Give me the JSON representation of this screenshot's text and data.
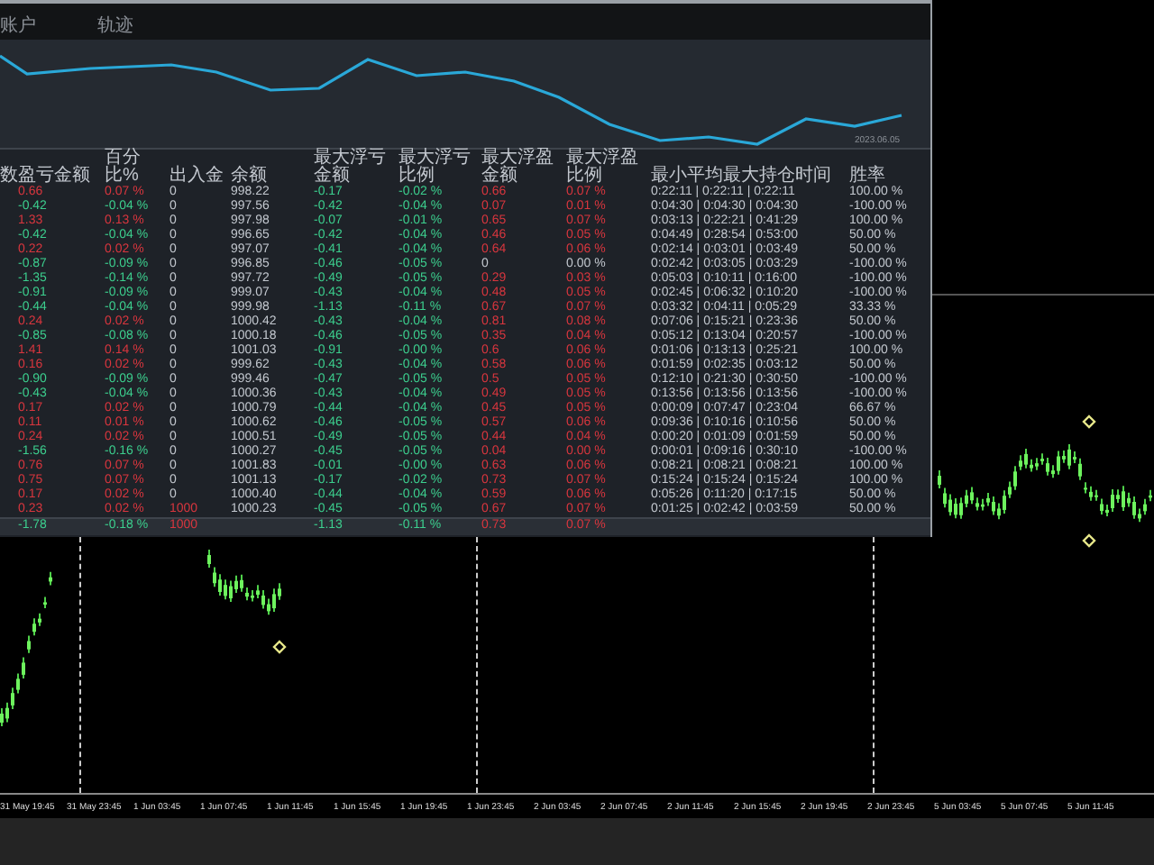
{
  "tabs": [
    {
      "label": "账户"
    },
    {
      "label": "轨迹"
    }
  ],
  "equity_chart": {
    "date_label": "2023.06.05"
  },
  "table": {
    "columns": [
      "数",
      "盈亏金额",
      "百分比%",
      "出入金",
      "余额",
      "最大浮亏金额",
      "最大浮亏比例",
      "最大浮盈金额",
      "最大浮盈比例",
      "最小平均最大持仓时间",
      "胜率"
    ],
    "rows": [
      {
        "cells": [
          {
            "text": ""
          },
          {
            "text": "0.66",
            "kind": "gain"
          },
          {
            "text": "0.07 %",
            "kind": "gain"
          },
          {
            "text": "0",
            "kind": "plain"
          },
          {
            "text": "998.22",
            "kind": "plain"
          },
          {
            "text": "-0.17",
            "kind": "loss"
          },
          {
            "text": "-0.02 %",
            "kind": "loss"
          },
          {
            "text": "0.66",
            "kind": "gain"
          },
          {
            "text": "0.07 %",
            "kind": "gain"
          },
          {
            "text": "0:22:11 | 0:22:11 | 0:22:11",
            "kind": "plain"
          },
          {
            "text": "100.00 %",
            "kind": "plain"
          }
        ]
      },
      {
        "cells": [
          {
            "text": ""
          },
          {
            "text": "-0.42",
            "kind": "loss"
          },
          {
            "text": "-0.04 %",
            "kind": "loss"
          },
          {
            "text": "0",
            "kind": "plain"
          },
          {
            "text": "997.56",
            "kind": "plain"
          },
          {
            "text": "-0.42",
            "kind": "loss"
          },
          {
            "text": "-0.04 %",
            "kind": "loss"
          },
          {
            "text": "0.07",
            "kind": "gain"
          },
          {
            "text": "0.01 %",
            "kind": "gain"
          },
          {
            "text": "0:04:30 | 0:04:30 | 0:04:30",
            "kind": "plain"
          },
          {
            "text": "-100.00 %",
            "kind": "plain"
          }
        ]
      },
      {
        "cells": [
          {
            "text": ""
          },
          {
            "text": "1.33",
            "kind": "gain"
          },
          {
            "text": "0.13 %",
            "kind": "gain"
          },
          {
            "text": "0",
            "kind": "plain"
          },
          {
            "text": "997.98",
            "kind": "plain"
          },
          {
            "text": "-0.07",
            "kind": "loss"
          },
          {
            "text": "-0.01 %",
            "kind": "loss"
          },
          {
            "text": "0.65",
            "kind": "gain"
          },
          {
            "text": "0.07 %",
            "kind": "gain"
          },
          {
            "text": "0:03:13 | 0:22:21 | 0:41:29",
            "kind": "plain"
          },
          {
            "text": "100.00 %",
            "kind": "plain"
          }
        ]
      },
      {
        "cells": [
          {
            "text": ""
          },
          {
            "text": "-0.42",
            "kind": "loss"
          },
          {
            "text": "-0.04 %",
            "kind": "loss"
          },
          {
            "text": "0",
            "kind": "plain"
          },
          {
            "text": "996.65",
            "kind": "plain"
          },
          {
            "text": "-0.42",
            "kind": "loss"
          },
          {
            "text": "-0.04 %",
            "kind": "loss"
          },
          {
            "text": "0.46",
            "kind": "gain"
          },
          {
            "text": "0.05 %",
            "kind": "gain"
          },
          {
            "text": "0:04:49 | 0:28:54 | 0:53:00",
            "kind": "plain"
          },
          {
            "text": "50.00 %",
            "kind": "plain"
          }
        ]
      },
      {
        "cells": [
          {
            "text": ""
          },
          {
            "text": "0.22",
            "kind": "gain"
          },
          {
            "text": "0.02 %",
            "kind": "gain"
          },
          {
            "text": "0",
            "kind": "plain"
          },
          {
            "text": "997.07",
            "kind": "plain"
          },
          {
            "text": "-0.41",
            "kind": "loss"
          },
          {
            "text": "-0.04 %",
            "kind": "loss"
          },
          {
            "text": "0.64",
            "kind": "gain"
          },
          {
            "text": "0.06 %",
            "kind": "gain"
          },
          {
            "text": "0:02:14 | 0:03:01 | 0:03:49",
            "kind": "plain"
          },
          {
            "text": "50.00 %",
            "kind": "plain"
          }
        ]
      },
      {
        "cells": [
          {
            "text": ""
          },
          {
            "text": "-0.87",
            "kind": "loss"
          },
          {
            "text": "-0.09 %",
            "kind": "loss"
          },
          {
            "text": "0",
            "kind": "plain"
          },
          {
            "text": "996.85",
            "kind": "plain"
          },
          {
            "text": "-0.46",
            "kind": "loss"
          },
          {
            "text": "-0.05 %",
            "kind": "loss"
          },
          {
            "text": "0",
            "kind": "plain"
          },
          {
            "text": "0.00 %",
            "kind": "plain"
          },
          {
            "text": "0:02:42 | 0:03:05 | 0:03:29",
            "kind": "plain"
          },
          {
            "text": "-100.00 %",
            "kind": "plain"
          }
        ]
      },
      {
        "cells": [
          {
            "text": ""
          },
          {
            "text": "-1.35",
            "kind": "loss"
          },
          {
            "text": "-0.14 %",
            "kind": "loss"
          },
          {
            "text": "0",
            "kind": "plain"
          },
          {
            "text": "997.72",
            "kind": "plain"
          },
          {
            "text": "-0.49",
            "kind": "loss"
          },
          {
            "text": "-0.05 %",
            "kind": "loss"
          },
          {
            "text": "0.29",
            "kind": "gain"
          },
          {
            "text": "0.03 %",
            "kind": "gain"
          },
          {
            "text": "0:05:03 | 0:10:11 | 0:16:00",
            "kind": "plain"
          },
          {
            "text": "-100.00 %",
            "kind": "plain"
          }
        ]
      },
      {
        "cells": [
          {
            "text": ""
          },
          {
            "text": "-0.91",
            "kind": "loss"
          },
          {
            "text": "-0.09 %",
            "kind": "loss"
          },
          {
            "text": "0",
            "kind": "plain"
          },
          {
            "text": "999.07",
            "kind": "plain"
          },
          {
            "text": "-0.43",
            "kind": "loss"
          },
          {
            "text": "-0.04 %",
            "kind": "loss"
          },
          {
            "text": "0.48",
            "kind": "gain"
          },
          {
            "text": "0.05 %",
            "kind": "gain"
          },
          {
            "text": "0:02:45 | 0:06:32 | 0:10:20",
            "kind": "plain"
          },
          {
            "text": "-100.00 %",
            "kind": "plain"
          }
        ]
      },
      {
        "cells": [
          {
            "text": ""
          },
          {
            "text": "-0.44",
            "kind": "loss"
          },
          {
            "text": "-0.04 %",
            "kind": "loss"
          },
          {
            "text": "0",
            "kind": "plain"
          },
          {
            "text": "999.98",
            "kind": "plain"
          },
          {
            "text": "-1.13",
            "kind": "loss"
          },
          {
            "text": "-0.11 %",
            "kind": "loss"
          },
          {
            "text": "0.67",
            "kind": "gain"
          },
          {
            "text": "0.07 %",
            "kind": "gain"
          },
          {
            "text": "0:03:32 | 0:04:11 | 0:05:29",
            "kind": "plain"
          },
          {
            "text": "33.33 %",
            "kind": "plain"
          }
        ]
      },
      {
        "cells": [
          {
            "text": ""
          },
          {
            "text": "0.24",
            "kind": "gain"
          },
          {
            "text": "0.02 %",
            "kind": "gain"
          },
          {
            "text": "0",
            "kind": "plain"
          },
          {
            "text": "1000.42",
            "kind": "plain"
          },
          {
            "text": "-0.43",
            "kind": "loss"
          },
          {
            "text": "-0.04 %",
            "kind": "loss"
          },
          {
            "text": "0.81",
            "kind": "gain"
          },
          {
            "text": "0.08 %",
            "kind": "gain"
          },
          {
            "text": "0:07:06 | 0:15:21 | 0:23:36",
            "kind": "plain"
          },
          {
            "text": "50.00 %",
            "kind": "plain"
          }
        ]
      },
      {
        "cells": [
          {
            "text": ""
          },
          {
            "text": "-0.85",
            "kind": "loss"
          },
          {
            "text": "-0.08 %",
            "kind": "loss"
          },
          {
            "text": "0",
            "kind": "plain"
          },
          {
            "text": "1000.18",
            "kind": "plain"
          },
          {
            "text": "-0.46",
            "kind": "loss"
          },
          {
            "text": "-0.05 %",
            "kind": "loss"
          },
          {
            "text": "0.35",
            "kind": "gain"
          },
          {
            "text": "0.04 %",
            "kind": "gain"
          },
          {
            "text": "0:05:12 | 0:13:04 | 0:20:57",
            "kind": "plain"
          },
          {
            "text": "-100.00 %",
            "kind": "plain"
          }
        ]
      },
      {
        "cells": [
          {
            "text": ""
          },
          {
            "text": "1.41",
            "kind": "gain"
          },
          {
            "text": "0.14 %",
            "kind": "gain"
          },
          {
            "text": "0",
            "kind": "plain"
          },
          {
            "text": "1001.03",
            "kind": "plain"
          },
          {
            "text": "-0.91",
            "kind": "loss"
          },
          {
            "text": "-0.00 %",
            "kind": "loss"
          },
          {
            "text": "0.6",
            "kind": "gain"
          },
          {
            "text": "0.06 %",
            "kind": "gain"
          },
          {
            "text": "0:01:06 | 0:13:13 | 0:25:21",
            "kind": "plain"
          },
          {
            "text": "100.00 %",
            "kind": "plain"
          }
        ]
      },
      {
        "cells": [
          {
            "text": ""
          },
          {
            "text": "0.16",
            "kind": "gain"
          },
          {
            "text": "0.02 %",
            "kind": "gain"
          },
          {
            "text": "0",
            "kind": "plain"
          },
          {
            "text": "999.62",
            "kind": "plain"
          },
          {
            "text": "-0.43",
            "kind": "loss"
          },
          {
            "text": "-0.04 %",
            "kind": "loss"
          },
          {
            "text": "0.58",
            "kind": "gain"
          },
          {
            "text": "0.06 %",
            "kind": "gain"
          },
          {
            "text": "0:01:59 | 0:02:35 | 0:03:12",
            "kind": "plain"
          },
          {
            "text": "50.00 %",
            "kind": "plain"
          }
        ]
      },
      {
        "cells": [
          {
            "text": ""
          },
          {
            "text": "-0.90",
            "kind": "loss"
          },
          {
            "text": "-0.09 %",
            "kind": "loss"
          },
          {
            "text": "0",
            "kind": "plain"
          },
          {
            "text": "999.46",
            "kind": "plain"
          },
          {
            "text": "-0.47",
            "kind": "loss"
          },
          {
            "text": "-0.05 %",
            "kind": "loss"
          },
          {
            "text": "0.5",
            "kind": "gain"
          },
          {
            "text": "0.05 %",
            "kind": "gain"
          },
          {
            "text": "0:12:10 | 0:21:30 | 0:30:50",
            "kind": "plain"
          },
          {
            "text": "-100.00 %",
            "kind": "plain"
          }
        ]
      },
      {
        "cells": [
          {
            "text": ""
          },
          {
            "text": "-0.43",
            "kind": "loss"
          },
          {
            "text": "-0.04 %",
            "kind": "loss"
          },
          {
            "text": "0",
            "kind": "plain"
          },
          {
            "text": "1000.36",
            "kind": "plain"
          },
          {
            "text": "-0.43",
            "kind": "loss"
          },
          {
            "text": "-0.04 %",
            "kind": "loss"
          },
          {
            "text": "0.49",
            "kind": "gain"
          },
          {
            "text": "0.05 %",
            "kind": "gain"
          },
          {
            "text": "0:13:56 | 0:13:56 | 0:13:56",
            "kind": "plain"
          },
          {
            "text": "-100.00 %",
            "kind": "plain"
          }
        ]
      },
      {
        "cells": [
          {
            "text": ""
          },
          {
            "text": "0.17",
            "kind": "gain"
          },
          {
            "text": "0.02 %",
            "kind": "gain"
          },
          {
            "text": "0",
            "kind": "plain"
          },
          {
            "text": "1000.79",
            "kind": "plain"
          },
          {
            "text": "-0.44",
            "kind": "loss"
          },
          {
            "text": "-0.04 %",
            "kind": "loss"
          },
          {
            "text": "0.45",
            "kind": "gain"
          },
          {
            "text": "0.05 %",
            "kind": "gain"
          },
          {
            "text": "0:00:09 | 0:07:47 | 0:23:04",
            "kind": "plain"
          },
          {
            "text": "66.67 %",
            "kind": "plain"
          }
        ]
      },
      {
        "cells": [
          {
            "text": ""
          },
          {
            "text": "0.11",
            "kind": "gain"
          },
          {
            "text": "0.01 %",
            "kind": "gain"
          },
          {
            "text": "0",
            "kind": "plain"
          },
          {
            "text": "1000.62",
            "kind": "plain"
          },
          {
            "text": "-0.46",
            "kind": "loss"
          },
          {
            "text": "-0.05 %",
            "kind": "loss"
          },
          {
            "text": "0.57",
            "kind": "gain"
          },
          {
            "text": "0.06 %",
            "kind": "gain"
          },
          {
            "text": "0:09:36 | 0:10:16 | 0:10:56",
            "kind": "plain"
          },
          {
            "text": "50.00 %",
            "kind": "plain"
          }
        ]
      },
      {
        "cells": [
          {
            "text": ""
          },
          {
            "text": "0.24",
            "kind": "gain"
          },
          {
            "text": "0.02 %",
            "kind": "gain"
          },
          {
            "text": "0",
            "kind": "plain"
          },
          {
            "text": "1000.51",
            "kind": "plain"
          },
          {
            "text": "-0.49",
            "kind": "loss"
          },
          {
            "text": "-0.05 %",
            "kind": "loss"
          },
          {
            "text": "0.44",
            "kind": "gain"
          },
          {
            "text": "0.04 %",
            "kind": "gain"
          },
          {
            "text": "0:00:20 | 0:01:09 | 0:01:59",
            "kind": "plain"
          },
          {
            "text": "50.00 %",
            "kind": "plain"
          }
        ]
      },
      {
        "cells": [
          {
            "text": ""
          },
          {
            "text": "-1.56",
            "kind": "loss"
          },
          {
            "text": "-0.16 %",
            "kind": "loss"
          },
          {
            "text": "0",
            "kind": "plain"
          },
          {
            "text": "1000.27",
            "kind": "plain"
          },
          {
            "text": "-0.45",
            "kind": "loss"
          },
          {
            "text": "-0.05 %",
            "kind": "loss"
          },
          {
            "text": "0.04",
            "kind": "gain"
          },
          {
            "text": "0.00 %",
            "kind": "gain"
          },
          {
            "text": "0:00:01 | 0:09:16 | 0:30:10",
            "kind": "plain"
          },
          {
            "text": "-100.00 %",
            "kind": "plain"
          }
        ]
      },
      {
        "cells": [
          {
            "text": ""
          },
          {
            "text": "0.76",
            "kind": "gain"
          },
          {
            "text": "0.07 %",
            "kind": "gain"
          },
          {
            "text": "0",
            "kind": "plain"
          },
          {
            "text": "1001.83",
            "kind": "plain"
          },
          {
            "text": "-0.01",
            "kind": "loss"
          },
          {
            "text": "-0.00 %",
            "kind": "loss"
          },
          {
            "text": "0.63",
            "kind": "gain"
          },
          {
            "text": "0.06 %",
            "kind": "gain"
          },
          {
            "text": "0:08:21 | 0:08:21 | 0:08:21",
            "kind": "plain"
          },
          {
            "text": "100.00 %",
            "kind": "plain"
          }
        ]
      },
      {
        "cells": [
          {
            "text": ""
          },
          {
            "text": "0.75",
            "kind": "gain"
          },
          {
            "text": "0.07 %",
            "kind": "gain"
          },
          {
            "text": "0",
            "kind": "plain"
          },
          {
            "text": "1001.13",
            "kind": "plain"
          },
          {
            "text": "-0.17",
            "kind": "loss"
          },
          {
            "text": "-0.02 %",
            "kind": "loss"
          },
          {
            "text": "0.73",
            "kind": "gain"
          },
          {
            "text": "0.07 %",
            "kind": "gain"
          },
          {
            "text": "0:15:24 | 0:15:24 | 0:15:24",
            "kind": "plain"
          },
          {
            "text": "100.00 %",
            "kind": "plain"
          }
        ]
      },
      {
        "cells": [
          {
            "text": ""
          },
          {
            "text": "0.17",
            "kind": "gain"
          },
          {
            "text": "0.02 %",
            "kind": "gain"
          },
          {
            "text": "0",
            "kind": "plain"
          },
          {
            "text": "1000.40",
            "kind": "plain"
          },
          {
            "text": "-0.44",
            "kind": "loss"
          },
          {
            "text": "-0.04 %",
            "kind": "loss"
          },
          {
            "text": "0.59",
            "kind": "gain"
          },
          {
            "text": "0.06 %",
            "kind": "gain"
          },
          {
            "text": "0:05:26 | 0:11:20 | 0:17:15",
            "kind": "plain"
          },
          {
            "text": "50.00 %",
            "kind": "plain"
          }
        ]
      },
      {
        "cells": [
          {
            "text": ""
          },
          {
            "text": "0.23",
            "kind": "gain"
          },
          {
            "text": "0.02 %",
            "kind": "gain"
          },
          {
            "text": "1000",
            "kind": "gain"
          },
          {
            "text": "1000.23",
            "kind": "plain"
          },
          {
            "text": "-0.45",
            "kind": "loss"
          },
          {
            "text": "-0.05 %",
            "kind": "loss"
          },
          {
            "text": "0.67",
            "kind": "gain"
          },
          {
            "text": "0.07 %",
            "kind": "gain"
          },
          {
            "text": "0:01:25 | 0:02:42 | 0:03:59",
            "kind": "plain"
          },
          {
            "text": "50.00 %",
            "kind": "plain"
          }
        ]
      },
      {
        "kind": "total",
        "cells": [
          {
            "text": ""
          },
          {
            "text": "-1.78",
            "kind": "loss"
          },
          {
            "text": "-0.18 %",
            "kind": "loss"
          },
          {
            "text": "1000",
            "kind": "gain"
          },
          {
            "text": ""
          },
          {
            "text": "-1.13",
            "kind": "loss"
          },
          {
            "text": "-0.11 %",
            "kind": "loss"
          },
          {
            "text": "0.73",
            "kind": "gain"
          },
          {
            "text": "0.07 %",
            "kind": "gain"
          }
        ]
      }
    ]
  },
  "time_axis": {
    "labels": [
      "31 May 19:45",
      "31 May 23:45",
      "1 Jun 03:45",
      "1 Jun 07:45",
      "1 Jun 11:45",
      "1 Jun 15:45",
      "1 Jun 19:45",
      "1 Jun 23:45",
      "2 Jun 03:45",
      "2 Jun 07:45",
      "2 Jun 11:45",
      "2 Jun 15:45",
      "2 Jun 19:45",
      "2 Jun 23:45",
      "5 Jun 03:45",
      "5 Jun 07:45",
      "5 Jun 11:45"
    ]
  }
}
